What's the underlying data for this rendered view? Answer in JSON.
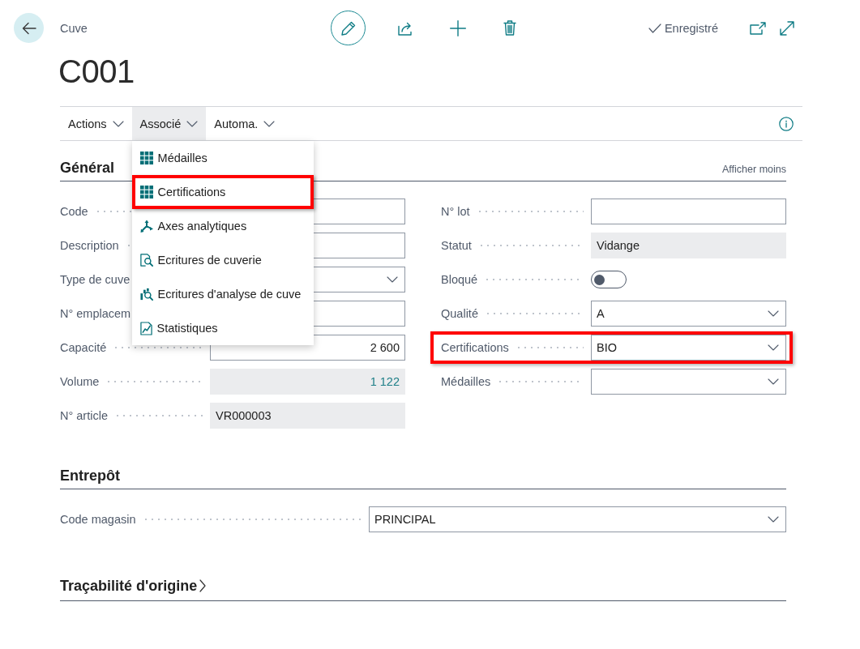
{
  "header": {
    "breadcrumb": "Cuve",
    "title": "C001",
    "save_status": "Enregistré"
  },
  "action_bar": {
    "tabs": [
      {
        "label": "Actions",
        "selected": false
      },
      {
        "label": "Associé",
        "selected": true
      },
      {
        "label": "Automa.",
        "selected": false
      }
    ],
    "menu": {
      "items": [
        {
          "label": "Médailles",
          "kind": "grid",
          "highlighted": false
        },
        {
          "label": "Certifications",
          "kind": "grid",
          "highlighted": true
        },
        {
          "label": "Axes analytiques",
          "kind": "branch",
          "highlighted": false
        },
        {
          "label": "Ecritures de cuverie",
          "kind": "ledger",
          "highlighted": false
        },
        {
          "label": "Ecritures d'analyse de cuve",
          "kind": "analysis",
          "highlighted": false
        },
        {
          "label": "Statistiques",
          "kind": "chart",
          "highlighted": false
        }
      ]
    }
  },
  "sections": [
    {
      "title": "Général",
      "expanded": true,
      "toggle_label": "Afficher moins",
      "columns": [
        [
          {
            "label": "Code",
            "kind": "text",
            "highlighted": false
          },
          {
            "label": "Description",
            "kind": "text",
            "highlighted": false
          },
          {
            "label": "Type de cuve",
            "kind": "select",
            "highlighted": false
          },
          {
            "label": "N° emplacem",
            "kind": "text",
            "highlighted": false
          },
          {
            "label": "Capacité",
            "kind": "number",
            "value": "2 600",
            "highlighted": false
          },
          {
            "label": "Volume",
            "kind": "drilldown",
            "value": "1 122",
            "highlighted": false
          },
          {
            "label": "N° article",
            "kind": "readonly",
            "value": "VR000003",
            "highlighted": false
          }
        ],
        [
          {
            "label": "N° lot",
            "kind": "text",
            "highlighted": false
          },
          {
            "label": "Statut",
            "kind": "readonly",
            "value": "Vidange",
            "highlighted": false
          },
          {
            "label": "Bloqué",
            "kind": "toggle",
            "on": false,
            "highlighted": false
          },
          {
            "label": "Qualité",
            "kind": "select",
            "value": "A",
            "highlighted": false
          },
          {
            "label": "Certifications",
            "kind": "select",
            "value": "BIO",
            "highlighted": true
          },
          {
            "label": "Médailles",
            "kind": "select",
            "highlighted": false
          }
        ]
      ]
    },
    {
      "title": "Entrepôt",
      "expanded": true,
      "columns": [
        [
          {
            "label": "Code magasin",
            "kind": "select",
            "value": "PRINCIPAL",
            "highlighted": false
          }
        ]
      ]
    },
    {
      "title": "Traçabilité d'origine",
      "expanded": false
    }
  ]
}
